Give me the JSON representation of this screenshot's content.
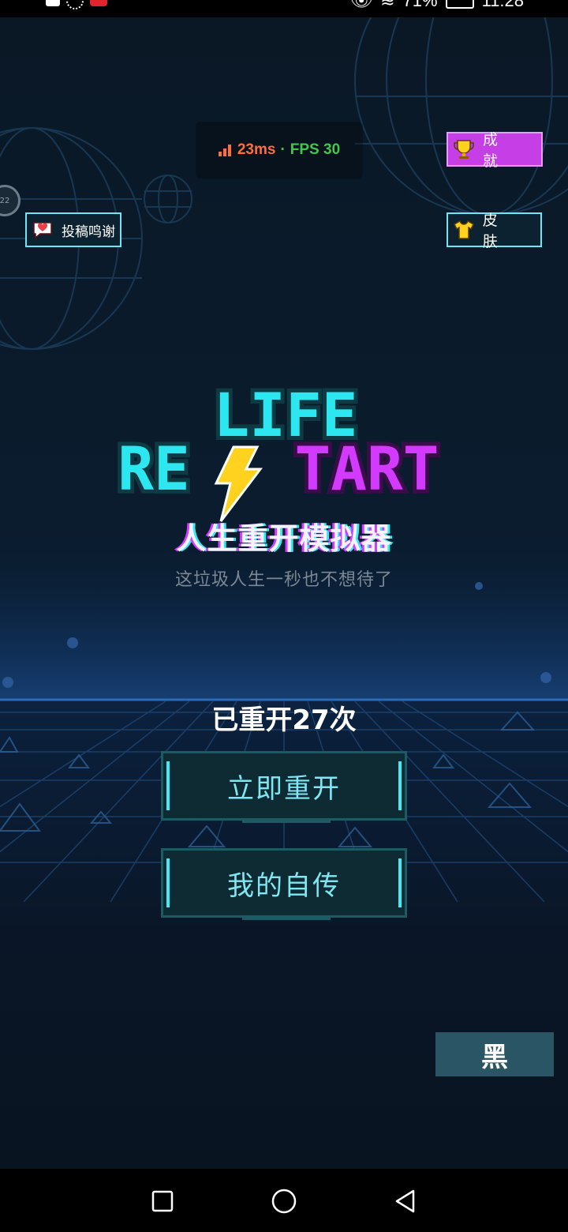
{
  "status_bar": {
    "battery": "71%",
    "time": "11:28"
  },
  "perf": {
    "latency": "23ms",
    "separator": "·",
    "fps": "FPS 30"
  },
  "buttons": {
    "achievements": "成 就",
    "skins": "皮 肤",
    "thanks": "投稿鸣谢",
    "theme": "黑"
  },
  "edge_badge": "22",
  "logo": {
    "line1": "LIFE",
    "line2_left": "RE",
    "line2_right": "TART"
  },
  "title_cn": "人生重开模拟器",
  "tagline": "这垃圾人生一秒也不想待了",
  "restart_count": "已重开27次",
  "actions": {
    "restart_now": "立即重开",
    "my_biography": "我的自传"
  },
  "colors": {
    "cyan": "#45e9f5",
    "magenta": "#d23bff",
    "bolt": "#ffd21f",
    "latency": "#ff6e3a",
    "fps": "#3ec94a"
  },
  "icons": {
    "achievements": "trophy-icon",
    "skins": "tshirt-icon",
    "thanks": "heart-bubble-icon",
    "nav": [
      "recent-apps-icon",
      "home-icon",
      "back-icon"
    ]
  }
}
